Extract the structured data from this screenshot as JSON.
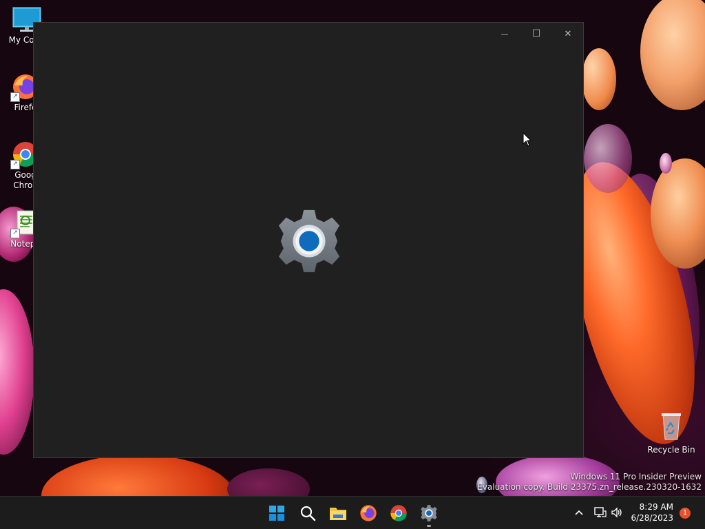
{
  "desktop": {
    "icons": [
      {
        "label": "My Com"
      },
      {
        "label": "Firefo"
      },
      {
        "label": "Goog\nChron"
      },
      {
        "label": "Notepa"
      }
    ],
    "recycle_bin": {
      "label": "Recycle Bin"
    }
  },
  "window": {
    "minimize_glyph": "—",
    "maximize_glyph": "☐",
    "close_glyph": "✕",
    "splash_icon": "settings-gear-icon"
  },
  "watermark": {
    "line1": "Windows 11 Pro Insider Preview",
    "line2": "Evaluation copy. Build 23375.zn_release.230320-1632"
  },
  "taskbar": {
    "apps": [
      "start-icon",
      "search-icon",
      "file-explorer-icon",
      "firefox-icon",
      "chrome-icon",
      "settings-icon"
    ],
    "tray": {
      "chevron": "^",
      "time": "8:29 AM",
      "date": "6/28/2023",
      "notification_count": "1"
    }
  },
  "colors": {
    "window_bg": "#202020",
    "taskbar_bg": "#1c1c1c",
    "accent": "#0f6cbd",
    "notification_badge": "#e8512a"
  }
}
